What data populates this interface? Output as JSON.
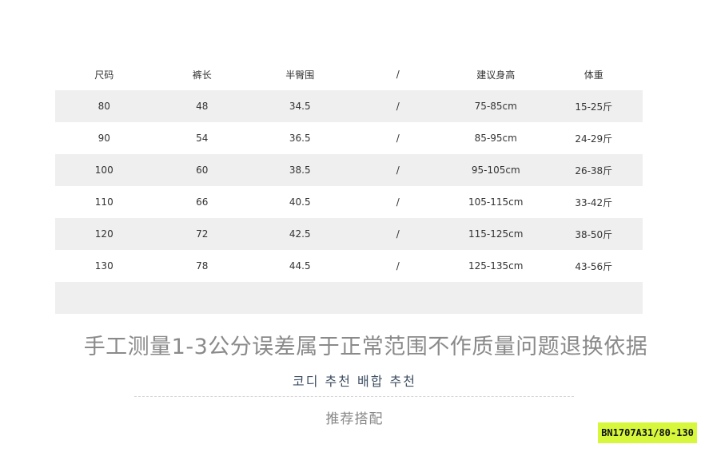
{
  "size_table": {
    "headers": [
      "尺码",
      "裤长",
      "半臀围",
      "/",
      "建议身高",
      "体重"
    ],
    "rows": [
      [
        "80",
        "48",
        "34.5",
        "/",
        "75-85cm",
        "15-25斤"
      ],
      [
        "90",
        "54",
        "36.5",
        "/",
        "85-95cm",
        "24-29斤"
      ],
      [
        "100",
        "60",
        "38.5",
        "/",
        "95-105cm",
        "26-38斤"
      ],
      [
        "110",
        "66",
        "40.5",
        "/",
        "105-115cm",
        "33-42斤"
      ],
      [
        "120",
        "72",
        "42.5",
        "/",
        "115-125cm",
        "38-50斤"
      ],
      [
        "130",
        "78",
        "44.5",
        "/",
        "125-135cm",
        "43-56斤"
      ],
      [
        "",
        "",
        "",
        "",
        "",
        ""
      ]
    ]
  },
  "disclaimer": "手工测量1-3公分误差属于正常范围不作质量问题退换依据",
  "coordi_label": "코디 추천 배합 추천",
  "recommend_label": "推荐搭配",
  "sku_badge": "BN1707A31/80-130",
  "colors": {
    "row_shade": "#efefef",
    "badge_bg": "#d6f73b"
  }
}
